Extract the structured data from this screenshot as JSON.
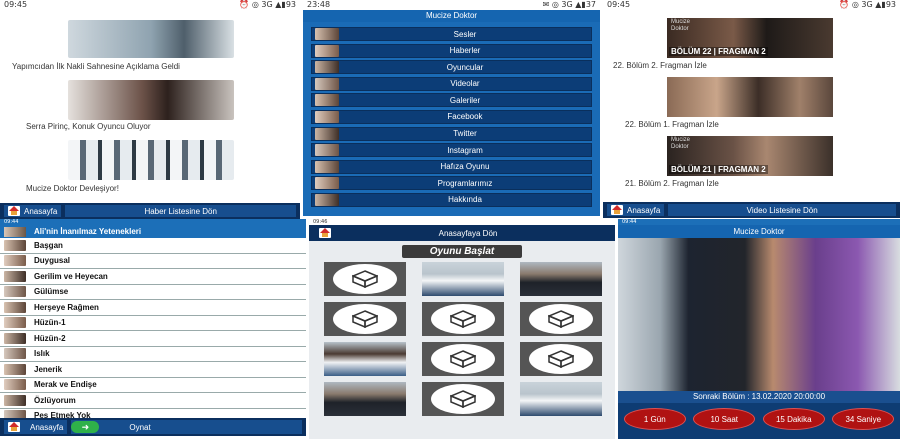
{
  "p1": {
    "status_time": "09:45",
    "status_icons": "⏰ ◎ 3G ▲▮93",
    "items": [
      {
        "caption": "Yapımcıdan İlk Nakli Sahnesine Açıklama Geldi"
      },
      {
        "caption": "Serra Pirinç, Konuk Oyuncu Oluyor"
      },
      {
        "caption": "Mucize Doktor Devleşiyor!"
      }
    ],
    "home_label": "Anasayfa",
    "back_label": "Haber Listesine Dön"
  },
  "p2": {
    "status_time": "23:48",
    "status_icons": "✉ ◎ 3G ▲▮37",
    "title": "Mucize Doktor",
    "menu": [
      "Sesler",
      "Haberler",
      "Oyuncular",
      "Videolar",
      "Galeriler",
      "Facebook",
      "Twitter",
      "Instagram",
      "Hafıza Oyunu",
      "Programlarımız",
      "Hakkında"
    ]
  },
  "p3": {
    "status_time": "09:45",
    "status_icons": "⏰ ◎ 3G ▲▮93",
    "items": [
      {
        "banner": "BÖLÜM 22 | FRAGMAN 2",
        "caption": "22. Bölüm 2. Fragman İzle"
      },
      {
        "banner": "",
        "caption": "22. Bölüm 1. Fragman İzle"
      },
      {
        "banner": "BÖLÜM 21 | FRAGMAN 2",
        "caption": "21. Bölüm 2. Fragman İzle"
      }
    ],
    "logo_text": "Mucize Doktor",
    "home_label": "Anasayfa",
    "back_label": "Video Listesine Dön"
  },
  "p4": {
    "status_time": "09:44",
    "header": "Ali'nin İnanılmaz Yetenekleri",
    "sounds": [
      "Başgan",
      "Duygusal",
      "Gerilim ve Heyecan",
      "Gülümse",
      "Herşeye Rağmen",
      "Hüzün-1",
      "Hüzün-2",
      "Islık",
      "Jenerik",
      "Merak ve Endişe",
      "Özlüyorum",
      "Pes Etmek Yok"
    ],
    "home_label": "Anasayfa",
    "play_label": "Oynat"
  },
  "p5": {
    "status_time": "09:46",
    "home_label": "Anasayfaya Dön",
    "start_label": "Oyunu Başlat",
    "cells": [
      "cube",
      "doctor",
      "man",
      "cube",
      "cube",
      "cube",
      "woman",
      "cube",
      "cube",
      "man",
      "cube",
      "doctor"
    ]
  },
  "p6": {
    "status_time": "09:44",
    "title": "Mucize Doktor",
    "next_episode": "Sonraki Bölüm : 13.02.2020 20:00:00",
    "countdown": [
      "1 Gün",
      "10 Saat",
      "15 Dakika",
      "34 Saniye"
    ]
  },
  "colors": {
    "primary": "#0b2f5e",
    "accent": "#1c6fb8",
    "countdown_red": "#b01212"
  }
}
